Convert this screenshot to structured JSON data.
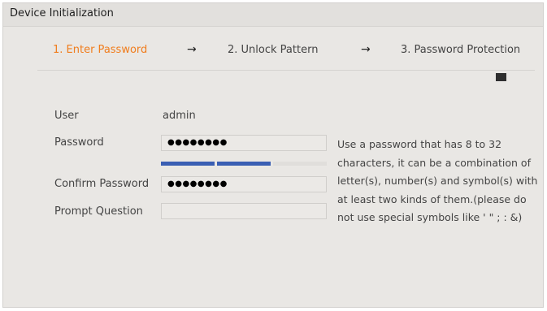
{
  "window": {
    "title": "Device Initialization"
  },
  "steps": [
    {
      "label": "1.  Enter Password",
      "active": true
    },
    {
      "label": "2.  Unlock Pattern",
      "active": false
    },
    {
      "label": "3.  Password Protection",
      "active": false
    }
  ],
  "step_arrow": "→",
  "form": {
    "user": {
      "label": "User",
      "value": "admin"
    },
    "password": {
      "label": "Password",
      "value": "●●●●●●●●"
    },
    "password_strength": {
      "segments_filled": 2,
      "segments_total": 3
    },
    "confirm_password": {
      "label": "Confirm Password",
      "value": "●●●●●●●●"
    },
    "prompt_question": {
      "label": "Prompt Question",
      "value": ""
    }
  },
  "hint": "Use a password that has 8 to 32 characters, it can be a combination of letter(s), number(s) and symbol(s) with at least two kinds of them.(please do not use special symbols like ' \" ; : &)",
  "colors": {
    "active_step": "#f07d1d",
    "strength_fill": "#3a5eb3",
    "dialog_bg": "#e9e7e4"
  }
}
